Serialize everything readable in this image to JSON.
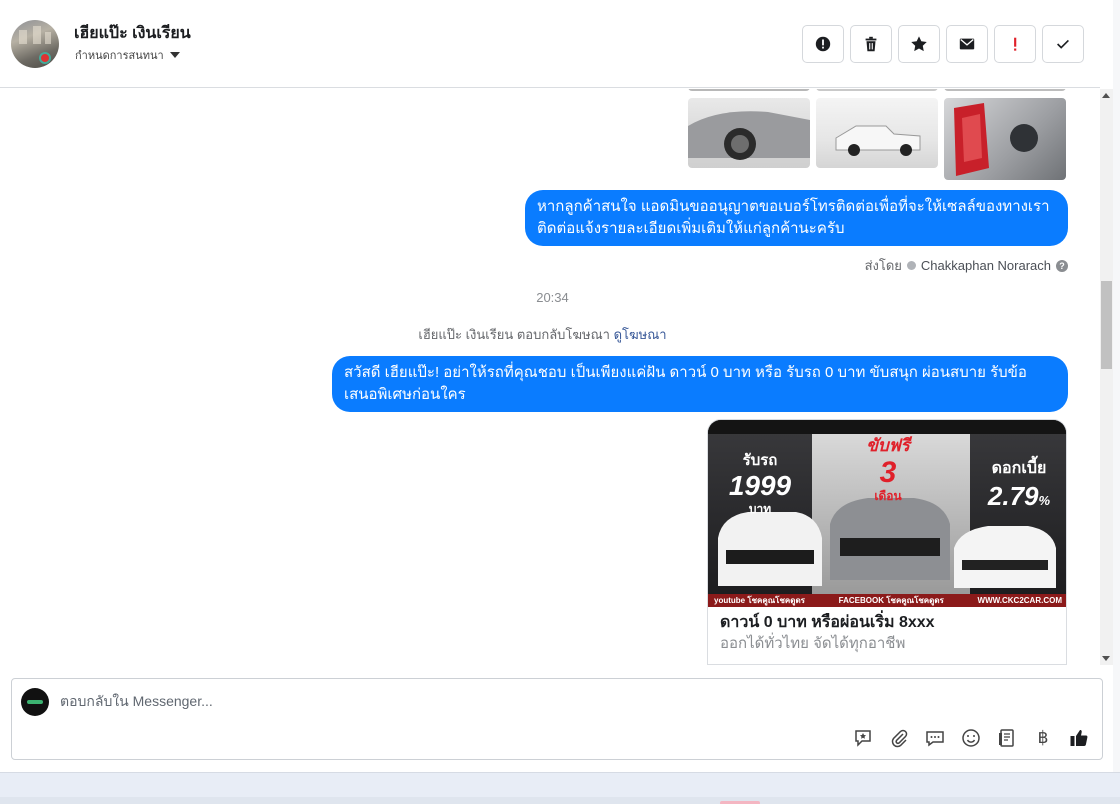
{
  "header": {
    "contact_name": "เฮียแป๊ะ เงินเรียน",
    "assign_label": "กำหนดการสนทนา",
    "actions": [
      {
        "name": "spam-report-button",
        "icon": "alert-circle-icon"
      },
      {
        "name": "delete-button",
        "icon": "trash-icon"
      },
      {
        "name": "star-button",
        "icon": "star-icon"
      },
      {
        "name": "mark-unread-button",
        "icon": "envelope-icon"
      },
      {
        "name": "follow-up-button",
        "icon": "exclamation-icon"
      },
      {
        "name": "mark-done-button",
        "icon": "checkmark-icon"
      }
    ]
  },
  "thread": {
    "messages": [
      {
        "id": "m1",
        "type": "text",
        "from": "page",
        "text": "หากลูกค้าสนใจ แอดมินขออนุญาตขอเบอร์โทรติดต่อเพื่อที่จะให้เซลล์ของทางเราติดต่อแจ้งรายละเอียดเพิ่มเติมให้แก่ลูกค้านะครับ"
      },
      {
        "id": "m2",
        "type": "text",
        "from": "page",
        "text": "สวัสดี เฮียแป๊ะ! อย่าให้รถที่คุณชอบ เป็นเพียงแค่ฝัน ดาวน์ 0 บาท หรือ รับรถ 0 บาท ขับสนุก ผ่อนสบาย รับข้อเสนอพิเศษก่อนใคร"
      }
    ],
    "sent_by_prefix": "ส่งโดย",
    "sent_by_name": "Chakkaphan Norarach",
    "help_glyph": "?",
    "timestamp": "20:34",
    "ad_reply_text": "เฮียแป๊ะ เงินเรียน ตอบกลับโฆษณา",
    "ad_reply_link": "ดูโฆษณา",
    "ad_card": {
      "title": "ดาวน์ 0 บาท หรือผ่อนเริ่ม 8xxx",
      "subtitle": "ออกได้ทั่วไทย จัดได้ทุกอาชีพ",
      "banner": {
        "left_label": "รับรถ",
        "left_number": "1999",
        "left_unit": "บาท",
        "center_label": "ขับฟรี",
        "center_number": "3",
        "center_unit": "เดือน",
        "right_label": "ดอกเบี้ย",
        "right_number": "2.79",
        "right_unit": "%",
        "footer_left": "youtube โชคคูณโชคดูดร",
        "footer_center": "FACEBOOK โชคคูณโชคดูดร",
        "footer_right": "WWW.CKC2CAR.COM"
      }
    }
  },
  "composer": {
    "placeholder": "ตอบกลับใน Messenger...",
    "tools": [
      "saved-reply-icon",
      "attachment-icon",
      "chat-bubble-icon",
      "emoji-icon",
      "document-icon",
      "baht-icon",
      "thumbs-up-icon"
    ],
    "baht_glyph": "฿"
  },
  "colors": {
    "bubble": "#0a7cff",
    "accent_link": "#385898",
    "ad_red": "#e0202a"
  }
}
